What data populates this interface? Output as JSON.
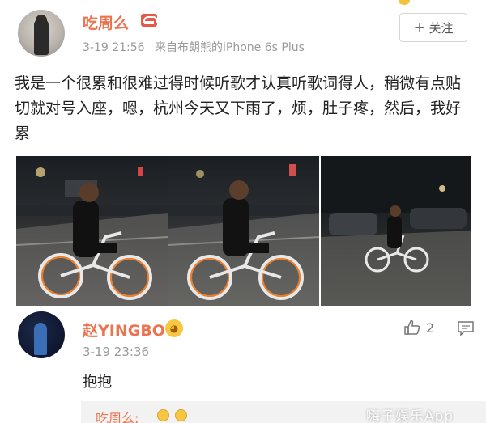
{
  "post": {
    "username": "吃周么",
    "time": "3-19 21:56",
    "source": "来自布朗熊的iPhone 6s Plus",
    "follow_label": "关注",
    "follow_icon": "plus-icon",
    "text": "我是一个很累和很难过得时候听歌才认真听歌词得人，稍微有点贴切就对号入座，嗯，杭州今天又下雨了，烦，肚子疼，然后，我好累",
    "photos": [
      "photo-cycling-1",
      "photo-cycling-2",
      "photo-cycling-3"
    ]
  },
  "comment": {
    "username": "赵YINGBO",
    "time": "3-19 23:36",
    "text": "抱抱",
    "like_count": "2",
    "like_icon": "thumbs-up-icon",
    "reply_icon": "comment-icon"
  },
  "nested_reply": {
    "username": "吃周么",
    "separator": ":"
  },
  "watermark": "嗨子娱乐App",
  "colors": {
    "username": "#eb7350",
    "meta": "#9a9a9a",
    "text": "#222222",
    "nested_bg": "#f2f2f2"
  }
}
